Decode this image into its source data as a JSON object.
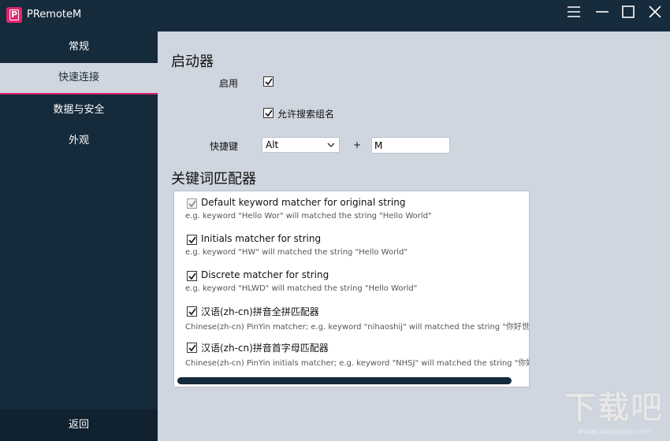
{
  "window": {
    "app_title": "PRemoteM",
    "logo_letter": "P",
    "controls": [
      "menu-icon",
      "minimize-icon",
      "maximize-icon",
      "close-icon"
    ]
  },
  "sidebar": {
    "items": [
      {
        "label": "常规",
        "active": false
      },
      {
        "label": "快速连接",
        "active": true
      },
      {
        "label": "数据与安全",
        "active": false
      },
      {
        "label": "外观",
        "active": false
      }
    ],
    "back_label": "返回"
  },
  "launcher": {
    "title": "启动器",
    "enable_label": "启用",
    "enable_checked": true,
    "allow_search_group_label": "允许搜索组名",
    "allow_search_group_checked": true,
    "hotkey_label": "快捷键",
    "hotkey_modifier": "Alt",
    "plus": "+",
    "hotkey_key": "M"
  },
  "keyword_matcher": {
    "title": "关键词匹配器",
    "items": [
      {
        "title": "Default keyword matcher for original string",
        "desc": "e.g. keyword \"Hello Wor\" will matched the string \"Hello World\"",
        "checked": true,
        "disabled": true
      },
      {
        "title": "Initials matcher for string",
        "desc": "e.g. keyword \"HW\" will matched the string \"Hello World\"",
        "checked": true,
        "disabled": false
      },
      {
        "title": "Discrete matcher for string",
        "desc": "e.g. keyword \"HLWD\" will matched the string \"Hello World\"",
        "checked": true,
        "disabled": false
      },
      {
        "title": "汉语(zh-cn)拼音全拼匹配器",
        "desc": "Chinese(zh-cn) PinYin matcher; e.g. keyword \"nihaoshij\" will matched the string \"你好世界\"",
        "checked": true,
        "disabled": false
      },
      {
        "title": "汉语(zh-cn)拼音首字母匹配器",
        "desc": "Chinese(zh-cn) PinYin initials matcher; e.g. keyword \"NHSJ\" will matched the string \"你好世界\"",
        "checked": true,
        "disabled": false
      }
    ]
  },
  "watermark": {
    "main": "下载吧",
    "sub": "www.xiazaiba.com"
  },
  "colors": {
    "sidebar": "#152a3b",
    "accent": "#e0256d",
    "content_bg": "#cfd6df"
  }
}
